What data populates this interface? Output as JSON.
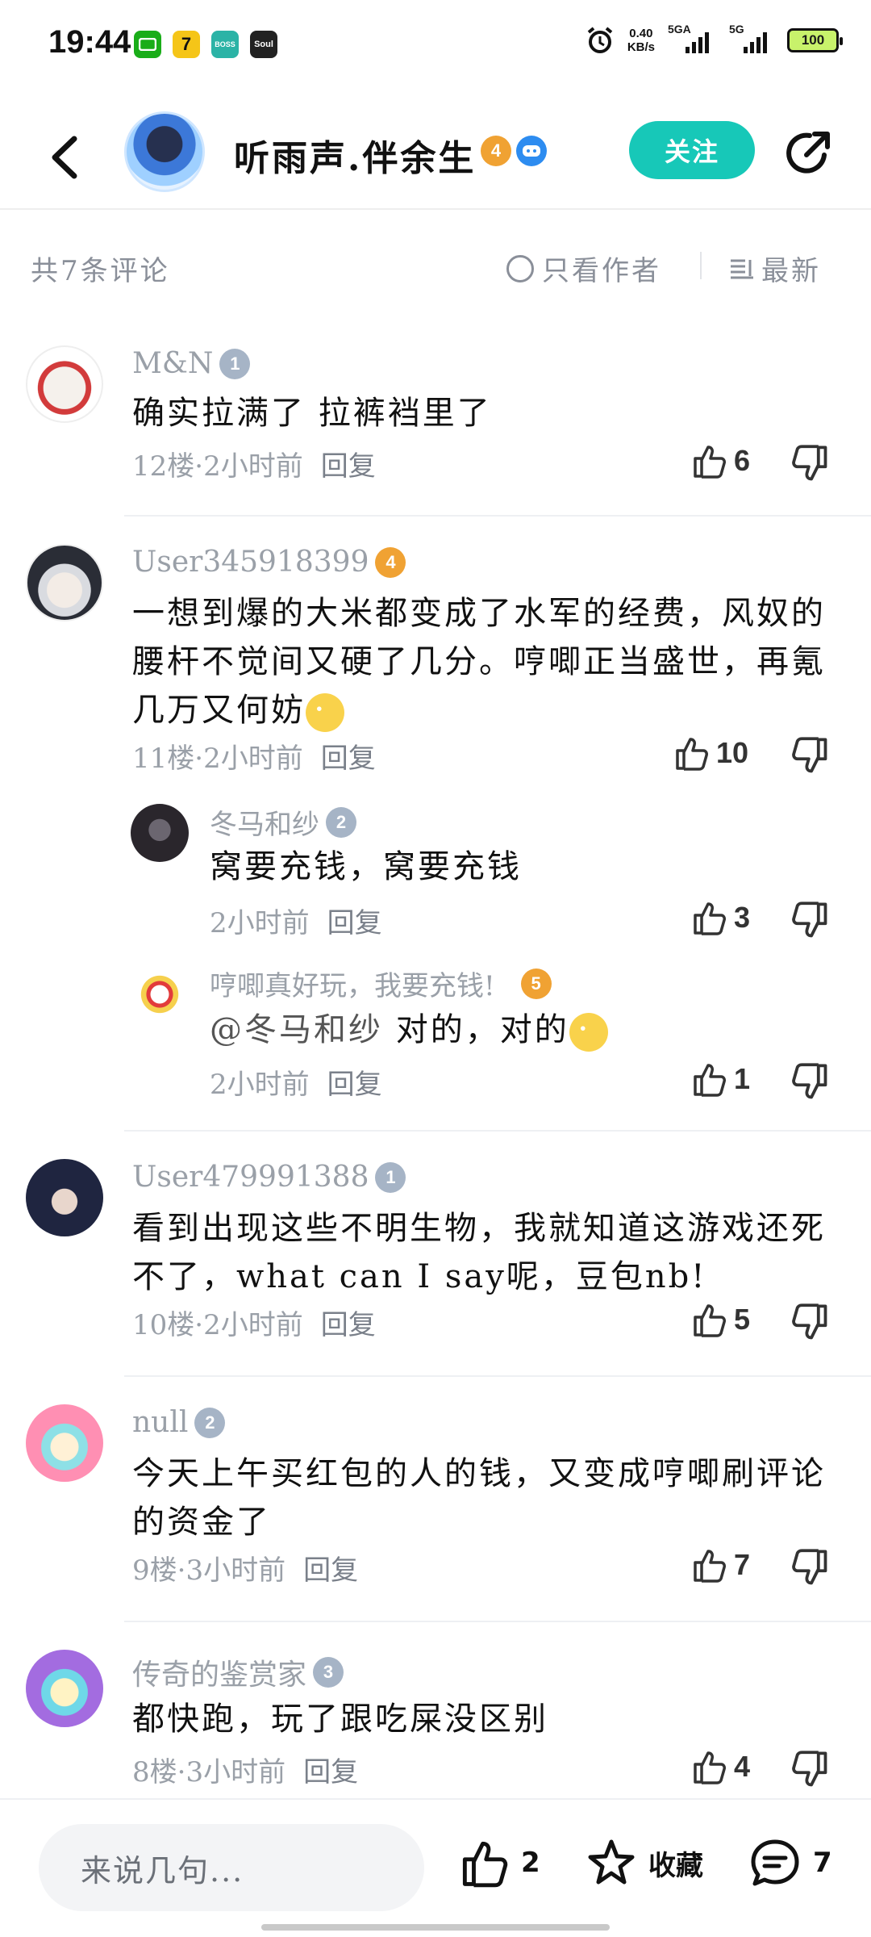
{
  "status_bar": {
    "time": "19:44",
    "app_icons": [
      {
        "name": "wechat-icon",
        "label": "",
        "color": "#1aad19"
      },
      {
        "name": "seven-app-icon",
        "label": "7",
        "color": "#f5c518"
      },
      {
        "name": "boss-app-icon",
        "label": "BOSS",
        "color": "#2bb3a6"
      },
      {
        "name": "soul-app-icon",
        "label": "Soul",
        "color": "#222222"
      }
    ],
    "net_speed_value": "0.40",
    "net_speed_unit": "KB/s",
    "signal1_label": "5GA",
    "signal2_label": "5G",
    "battery": "100"
  },
  "header": {
    "user_name": "听雨声.伴余生",
    "level_badge": "4",
    "follow_label": "关注"
  },
  "sort_bar": {
    "comment_count": "共7条评论",
    "author_only_label": "只看作者",
    "sort_label": "最新"
  },
  "comments": [
    {
      "user": "M&N",
      "level": "1",
      "level_color": "gray",
      "text": "确实拉满了 拉裤裆里了",
      "meta": "12楼·2小时前",
      "reply": "回复",
      "likes": "6"
    },
    {
      "user": "User345918399",
      "level": "4",
      "level_color": "gold",
      "text": "一想到爆的大米都变成了水军的经费，风奴的腰杆不觉间又硬了几分。哼唧正当盛世，再氪几万又何妨",
      "meta": "11楼·2小时前",
      "reply": "回复",
      "likes": "10"
    },
    {
      "user": "User479991388",
      "level": "1",
      "level_color": "gray",
      "text": "看到出现这些不明生物，我就知道这游戏还死不了，what can I say呢，豆包nb!",
      "meta": "10楼·2小时前",
      "reply": "回复",
      "likes": "5"
    },
    {
      "user": "null",
      "level": "2",
      "level_color": "gray",
      "text": "今天上午买红包的人的钱，又变成哼唧刷评论的资金了",
      "meta": "9楼·3小时前",
      "reply": "回复",
      "likes": "7"
    },
    {
      "user": "传奇的鉴赏家",
      "level": "3",
      "level_color": "gray",
      "text": "都快跑，玩了跟吃屎没区别",
      "meta": "8楼·3小时前",
      "reply": "回复",
      "likes": "4"
    }
  ],
  "replies": [
    {
      "user": "冬马和纱",
      "level": "2",
      "text": "窝要充钱，窝要充钱",
      "meta": "2小时前",
      "reply": "回复",
      "likes": "3"
    },
    {
      "user": "哼唧真好玩，我要充钱!",
      "level": "5",
      "mention": "@冬马和纱",
      "text": "对的，对的",
      "meta": "2小时前",
      "reply": "回复",
      "likes": "1"
    }
  ],
  "bottom_bar": {
    "input_placeholder": "来说几句...",
    "like_count": "2",
    "favorite_label": "收藏",
    "comment_count": "7"
  },
  "colors": {
    "accent": "#17c8b8",
    "text_secondary": "#9aa0a8",
    "level_gold": "#f0a233",
    "level_gray": "#a6b4c6"
  }
}
